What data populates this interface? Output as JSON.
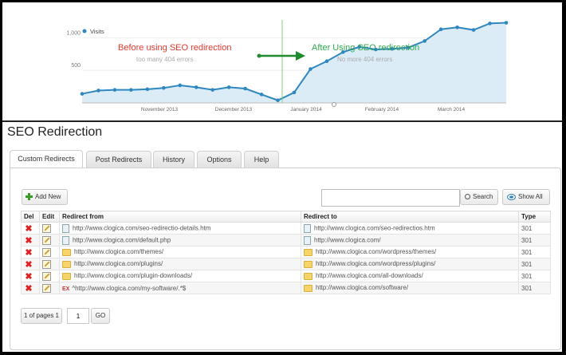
{
  "chart_data": {
    "type": "area",
    "legend": "Visits",
    "yticks": [
      "1,000",
      "500"
    ],
    "ylim": [
      0,
      1200
    ],
    "xlabels": [
      "November 2013",
      "December 2013",
      "January 2014",
      "February 2014",
      "March 2014"
    ],
    "values": [
      140,
      190,
      200,
      200,
      210,
      230,
      270,
      240,
      200,
      240,
      220,
      130,
      40,
      160,
      520,
      640,
      780,
      860,
      820,
      830,
      850,
      950,
      1130,
      1160,
      1120,
      1220,
      1230
    ],
    "annotations": {
      "before_title": "Before using SEO redirection",
      "before_sub": "too many 404 errors",
      "after_title": "After Using SEO redirection",
      "after_sub": "No more 404 errors"
    },
    "colors": {
      "line": "#2f87c0",
      "fill": "#dcecf7",
      "before": "#e0392f",
      "after": "#2fa84f",
      "arrow": "#1e8b2e",
      "marker": "#7fcf6f"
    }
  },
  "page": {
    "title": "SEO Redirection"
  },
  "tabs": [
    "Custom Redirects",
    "Post Redirects",
    "History",
    "Options",
    "Help"
  ],
  "toolbar": {
    "add_new": "Add New",
    "search": "Search",
    "show_all": "Show All",
    "search_value": ""
  },
  "table": {
    "headers": [
      "Del",
      "Edit",
      "Redirect from",
      "Redirect to",
      "Type"
    ],
    "rows": [
      {
        "from": "http://www.clogica.com/seo-redirectio-details.htm",
        "from_icon": "page-icon",
        "to": "http://www.clogica.com/seo-redirectios.htm",
        "to_icon": "page-icon",
        "type": "301"
      },
      {
        "from": "http://www.clogica.com/default.php",
        "from_icon": "page-icon",
        "to": "http://www.clogica.com/",
        "to_icon": "page-icon",
        "type": "301"
      },
      {
        "from": "http://www.clogica.com/themes/",
        "from_icon": "folder-icon",
        "to": "http://www.clogica.com/wordpress/themes/",
        "to_icon": "folder-icon",
        "type": "301"
      },
      {
        "from": "http://www.clogica.com/plugins/",
        "from_icon": "folder-icon",
        "to": "http://www.clogica.com/wordpress/plugins/",
        "to_icon": "folder-icon",
        "type": "301"
      },
      {
        "from": "http://www.clogica.com/plugin-downloads/",
        "from_icon": "folder-icon",
        "to": "http://www.clogica.com/all-downloads/",
        "to_icon": "folder-icon",
        "type": "301"
      },
      {
        "from": "^http://www.clogica.com/my-software/.*$",
        "from_icon": "regex-icon",
        "from_prefix": "EX",
        "to": "http://www.clogica.com/software/",
        "to_icon": "folder-icon",
        "type": "301"
      }
    ]
  },
  "pager": {
    "label": "1 of pages 1",
    "page_value": "1",
    "go": "GO"
  }
}
